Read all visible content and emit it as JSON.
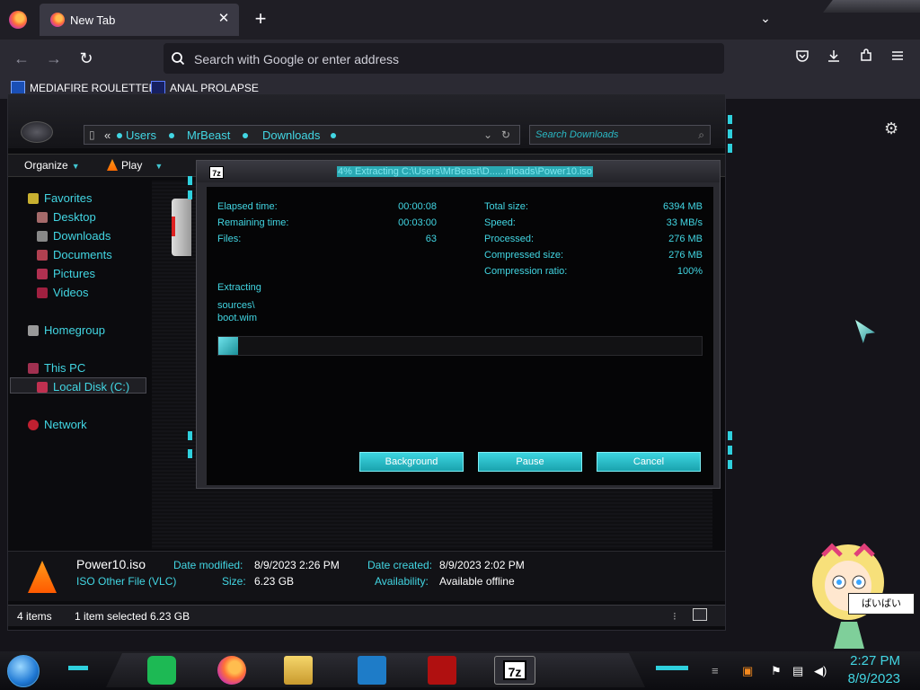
{
  "browser": {
    "tab": {
      "title": "New Tab",
      "close_glyph": "✕"
    },
    "new_tab_glyph": "+",
    "tab_list_glyph": "⌄",
    "nav": {
      "back": "←",
      "forward": "→",
      "reload": "↻"
    },
    "urlbar": {
      "placeholder": "Search with Google or enter address"
    },
    "toolbar_icons": [
      "pocket-icon",
      "download-icon",
      "extensions-icon",
      "menu-icon"
    ],
    "bookmarks": [
      "MEDIAFIRE ROULETTER",
      "ANAL PROLAPSE"
    ]
  },
  "explorer": {
    "address": {
      "prefix": "«",
      "crumbs": [
        "Users",
        "MrBeast",
        "Downloads"
      ]
    },
    "search_placeholder": "Search Downloads",
    "commands": [
      "Organize",
      "Play"
    ],
    "nav": {
      "favorites": "Favorites",
      "favorites_items": [
        "Desktop",
        "Downloads",
        "Documents",
        "Pictures",
        "Videos"
      ],
      "homegroup": "Homegroup",
      "this_pc": "This PC",
      "local_disk": "Local Disk (C:)",
      "network": "Network"
    },
    "details": {
      "name": "Power10.iso",
      "type": "ISO Other File (VLC)",
      "date_modified_label": "Date modified:",
      "date_modified": "8/9/2023 2:26 PM",
      "size_label": "Size:",
      "size": "6.23 GB",
      "date_created_label": "Date created:",
      "date_created": "8/9/2023 2:02 PM",
      "availability_label": "Availability:",
      "availability": "Available offline"
    },
    "status": {
      "items": "4 items",
      "selected": "1 item selected  6.23 GB"
    }
  },
  "dialog": {
    "title": "4% Extracting C:\\Users\\MrBeast\\D......nloads\\Power10.iso",
    "left": [
      {
        "label": "Elapsed time:",
        "value": "00:00:08"
      },
      {
        "label": "Remaining time:",
        "value": "00:03:00"
      },
      {
        "label": "Files:",
        "value": "63"
      }
    ],
    "right": [
      {
        "label": "Total size:",
        "value": "6394 MB"
      },
      {
        "label": "Speed:",
        "value": "33 MB/s"
      },
      {
        "label": "Processed:",
        "value": "276 MB"
      },
      {
        "label": "Compressed size:",
        "value": "276 MB"
      },
      {
        "label": "Compression ratio:",
        "value": "100%"
      }
    ],
    "status": "Extracting",
    "path": "sources\\",
    "file": "boot.wim",
    "progress_percent": 4,
    "buttons": {
      "background": "Background",
      "pause": "Pause",
      "cancel": "Cancel"
    }
  },
  "desktop": {
    "speech_bubble": "ばいばい"
  },
  "taskbar": {
    "apps": [
      "spotify-icon",
      "firefox-icon",
      "file-explorer-icon",
      "remote-icon",
      "flash-icon",
      "7zip-icon"
    ],
    "time": "2:27 PM",
    "date": "8/9/2023"
  },
  "colors": {
    "accent": "#42d6e3",
    "button": "#1aa3ae",
    "background": "#141318"
  }
}
